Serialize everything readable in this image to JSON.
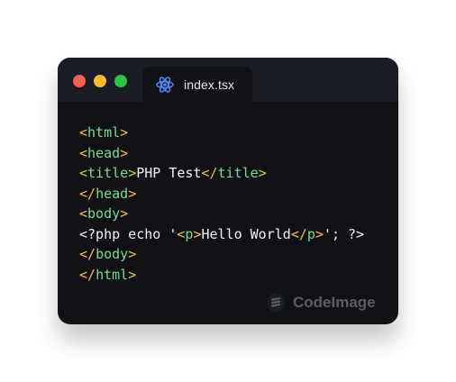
{
  "window": {
    "traffic_lights": [
      "close",
      "minimize",
      "maximize"
    ],
    "tab": {
      "label": "index.tsx",
      "icon": "react-icon"
    }
  },
  "code": {
    "lines": [
      [
        {
          "text": "<",
          "kind": "bracket"
        },
        {
          "text": "html",
          "kind": "tag"
        },
        {
          "text": ">",
          "kind": "bracket"
        }
      ],
      [
        {
          "text": "<",
          "kind": "bracket"
        },
        {
          "text": "head",
          "kind": "tag"
        },
        {
          "text": ">",
          "kind": "bracket"
        }
      ],
      [
        {
          "text": "<",
          "kind": "bracket"
        },
        {
          "text": "title",
          "kind": "tag"
        },
        {
          "text": ">",
          "kind": "bracket"
        },
        {
          "text": "PHP Test",
          "kind": "text"
        },
        {
          "text": "</",
          "kind": "bracket"
        },
        {
          "text": "title",
          "kind": "tag"
        },
        {
          "text": ">",
          "kind": "bracket"
        }
      ],
      [
        {
          "text": "</",
          "kind": "bracket"
        },
        {
          "text": "head",
          "kind": "tag"
        },
        {
          "text": ">",
          "kind": "bracket"
        }
      ],
      [
        {
          "text": "<",
          "kind": "bracket"
        },
        {
          "text": "body",
          "kind": "tag"
        },
        {
          "text": ">",
          "kind": "bracket"
        }
      ],
      [
        {
          "text": "<?php echo '",
          "kind": "text"
        },
        {
          "text": "<",
          "kind": "bracket"
        },
        {
          "text": "p",
          "kind": "tag"
        },
        {
          "text": ">",
          "kind": "bracket"
        },
        {
          "text": "Hello World",
          "kind": "text"
        },
        {
          "text": "</",
          "kind": "bracket"
        },
        {
          "text": "p",
          "kind": "tag"
        },
        {
          "text": ">",
          "kind": "bracket"
        },
        {
          "text": "'; ?>",
          "kind": "text"
        }
      ],
      [
        {
          "text": "</",
          "kind": "bracket"
        },
        {
          "text": "body",
          "kind": "tag"
        },
        {
          "text": ">",
          "kind": "bracket"
        }
      ],
      [
        {
          "text": "</",
          "kind": "bracket"
        },
        {
          "text": "html",
          "kind": "tag"
        },
        {
          "text": ">",
          "kind": "bracket"
        }
      ]
    ]
  },
  "watermark": {
    "label": "CodeImage",
    "icon": "codeimage-logo-icon"
  },
  "colors": {
    "page_background": "#ffffff",
    "window_background": "#0f1117",
    "titlebar_background": "#1a1d24",
    "traffic_red": "#ff5f57",
    "traffic_yellow": "#febc2e",
    "traffic_green": "#28c840",
    "react_icon": "#4b8df8",
    "bracket": "#f4c152",
    "tag": "#7fdc8d",
    "code_text": "#f1f3f8",
    "watermark": "#61646d"
  }
}
